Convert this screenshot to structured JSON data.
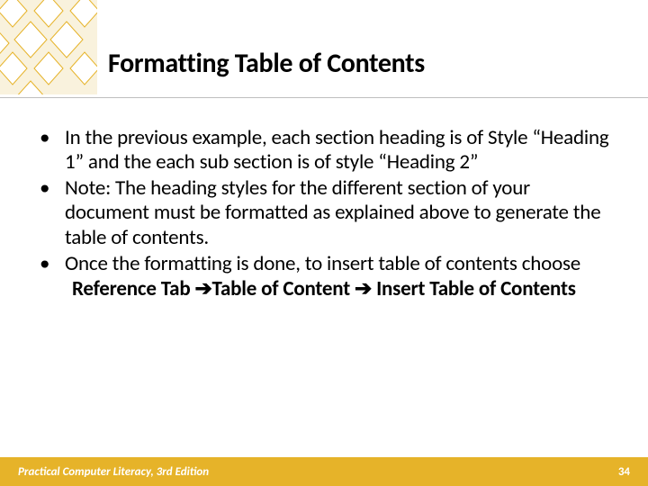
{
  "slide": {
    "title": "Formatting Table of Contents",
    "bullets": [
      "In the previous example, each section heading is of Style “Heading 1” and the each sub section is of style “Heading 2”",
      "Note: The heading styles for the different section of your document must be formatted as explained above to generate the table of contents.",
      "Once the formatting is done, to insert table of contents choose"
    ],
    "path": {
      "p1": "Reference Tab ",
      "p2": "Table of Content ",
      "p3": " Insert Table of Contents",
      "arrow": "➔"
    }
  },
  "footer": {
    "book": "Practical Computer Literacy, 3rd Edition",
    "page": "34"
  },
  "colors": {
    "accent": "#E6B329",
    "decoLight": "#F9F2DD",
    "decoOutline": "#E6B329"
  }
}
